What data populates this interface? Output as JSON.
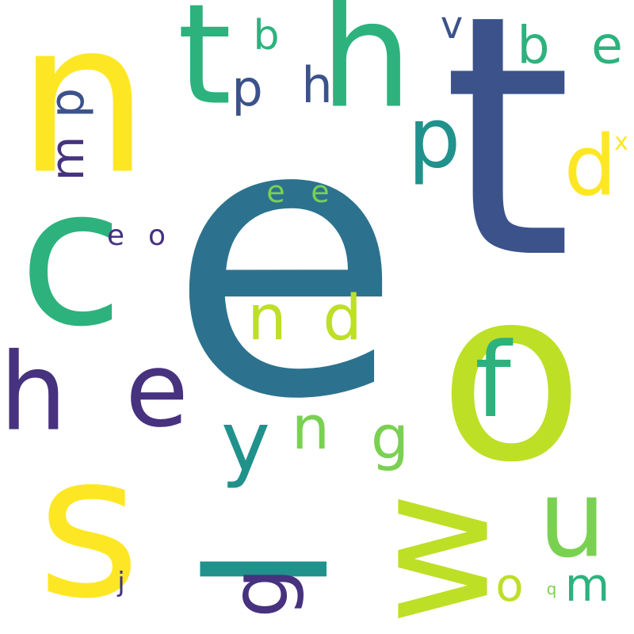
{
  "palette": {
    "background": "#ffffff",
    "yellow": "#fde725",
    "lime": "#bddf26",
    "light-green": "#7ad151",
    "green": "#2db27d",
    "teal": "#21918c",
    "steel-blue": "#2c728e",
    "slate-blue": "#3b528b",
    "indigo": "#46327e"
  },
  "words": [
    {
      "text": "e",
      "color": "steel-blue"
    },
    {
      "text": "t",
      "color": "slate-blue"
    },
    {
      "text": "o",
      "color": "lime"
    },
    {
      "text": "n",
      "color": "yellow"
    },
    {
      "text": "s",
      "color": "yellow"
    },
    {
      "text": "c",
      "color": "green"
    },
    {
      "text": "h",
      "color": "green"
    },
    {
      "text": "t",
      "color": "green"
    },
    {
      "text": "l",
      "color": "teal"
    },
    {
      "text": "w",
      "color": "lime"
    },
    {
      "text": "h",
      "color": "indigo"
    },
    {
      "text": "e",
      "color": "indigo"
    },
    {
      "text": "f",
      "color": "green"
    },
    {
      "text": "u",
      "color": "light-green"
    },
    {
      "text": "y",
      "color": "teal"
    },
    {
      "text": "p",
      "color": "teal"
    },
    {
      "text": "d",
      "color": "yellow"
    },
    {
      "text": "g",
      "color": "indigo"
    },
    {
      "text": "n",
      "color": "lime"
    },
    {
      "text": "d",
      "color": "lime"
    },
    {
      "text": "n",
      "color": "light-green"
    },
    {
      "text": "g",
      "color": "light-green"
    },
    {
      "text": "b",
      "color": "green"
    },
    {
      "text": "e",
      "color": "green"
    },
    {
      "text": "p",
      "color": "slate-blue"
    },
    {
      "text": "h",
      "color": "slate-blue"
    },
    {
      "text": "p",
      "color": "slate-blue"
    },
    {
      "text": "m",
      "color": "indigo"
    },
    {
      "text": "b",
      "color": "green"
    },
    {
      "text": "v",
      "color": "slate-blue"
    },
    {
      "text": "o",
      "color": "lime"
    },
    {
      "text": "m",
      "color": "green"
    },
    {
      "text": "e",
      "color": "light-green"
    },
    {
      "text": "e",
      "color": "light-green"
    },
    {
      "text": "e",
      "color": "indigo"
    },
    {
      "text": "o",
      "color": "indigo"
    },
    {
      "text": "x",
      "color": "yellow"
    },
    {
      "text": "j",
      "color": "indigo"
    },
    {
      "text": "q",
      "color": "light-green"
    }
  ]
}
